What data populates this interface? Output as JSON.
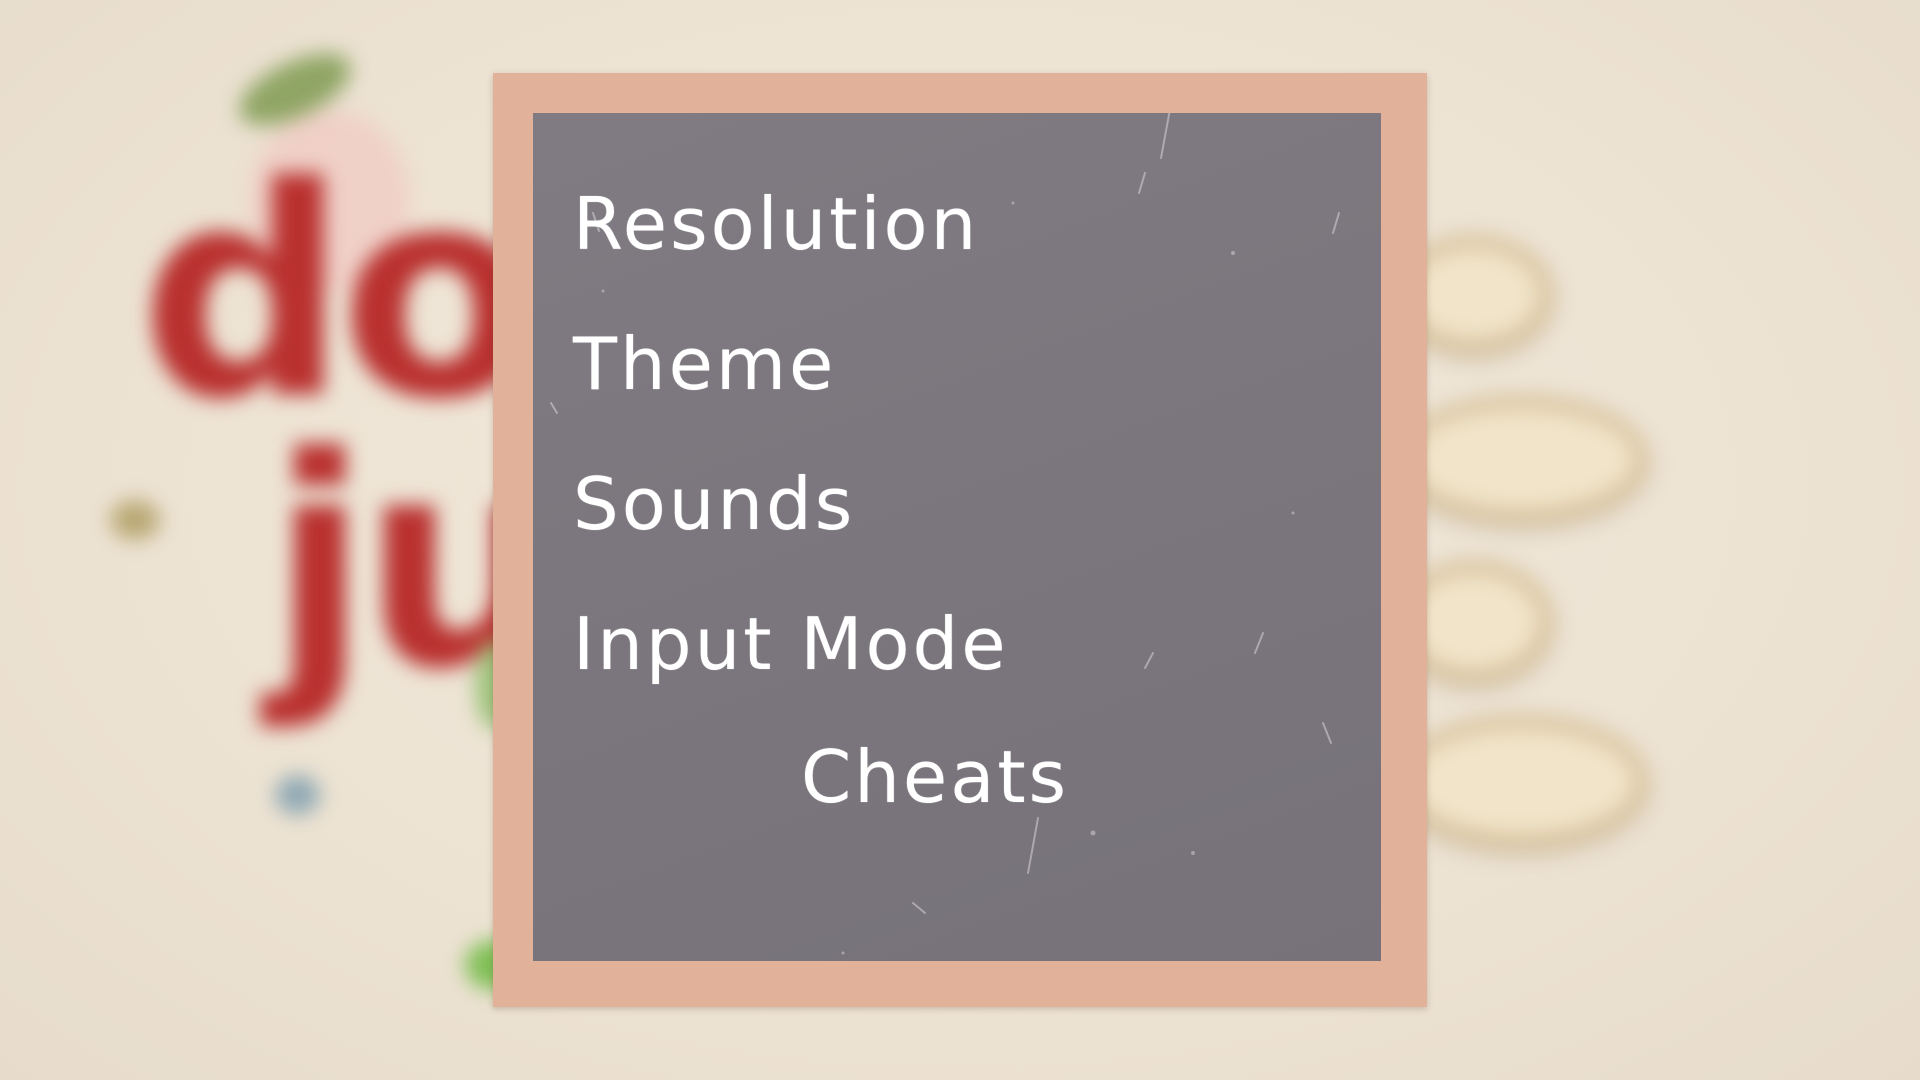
{
  "colors": {
    "frame": "#e2b19a",
    "board": "#7d787f",
    "menu_text": "#ffffff",
    "background": "#efe6d8",
    "logo": "#b9302f"
  },
  "menu": {
    "items": [
      {
        "id": "resolution",
        "label": "Resolution"
      },
      {
        "id": "theme",
        "label": "Theme"
      },
      {
        "id": "sounds",
        "label": "Sounds"
      },
      {
        "id": "input-mode",
        "label": "Input Mode"
      },
      {
        "id": "cheats",
        "label": "Cheats"
      }
    ]
  }
}
